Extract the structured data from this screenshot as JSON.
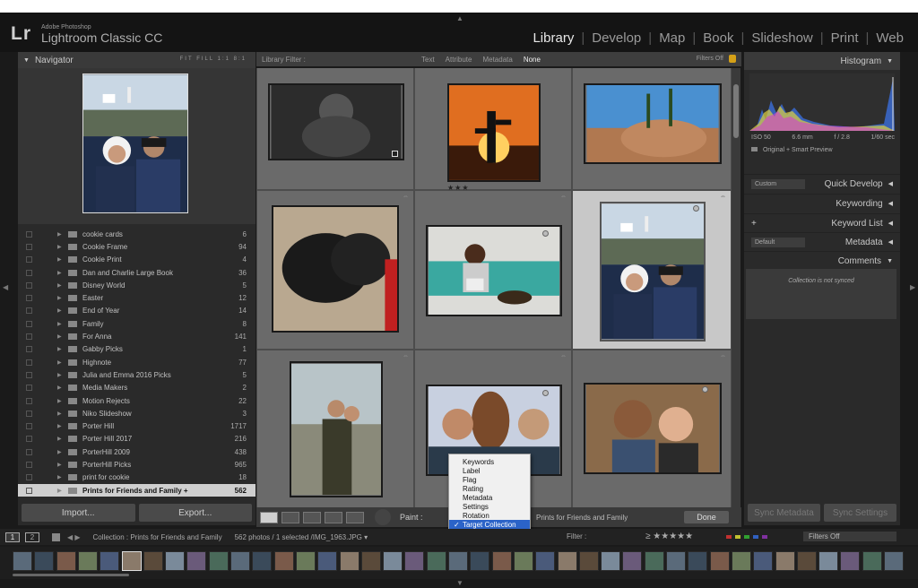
{
  "app": {
    "brand_small": "Adobe Photoshop",
    "brand_big": "Lightroom Classic CC",
    "logo": "Lr",
    "modules": [
      "Library",
      "Develop",
      "Map",
      "Book",
      "Slideshow",
      "Print",
      "Web"
    ],
    "active_module": "Library"
  },
  "navigator": {
    "title": "Navigator",
    "zoom_options": "FIT  FILL  1:1  8:1"
  },
  "collections": [
    {
      "name": "cookie cards",
      "count": "6"
    },
    {
      "name": "Cookie Frame",
      "count": "94"
    },
    {
      "name": "Cookie Print",
      "count": "4"
    },
    {
      "name": "Dan and Charlie Large Book",
      "count": "36"
    },
    {
      "name": "Disney World",
      "count": "5"
    },
    {
      "name": "Easter",
      "count": "12"
    },
    {
      "name": "End of Year",
      "count": "14"
    },
    {
      "name": "Family",
      "count": "8"
    },
    {
      "name": "For Anna",
      "count": "141"
    },
    {
      "name": "Gabby Picks",
      "count": "1"
    },
    {
      "name": "Highnote",
      "count": "77"
    },
    {
      "name": "Julia and Emma 2016 Picks",
      "count": "5"
    },
    {
      "name": "Media Makers",
      "count": "2"
    },
    {
      "name": "Motion Rejects",
      "count": "22"
    },
    {
      "name": "Niko Slideshow",
      "count": "3"
    },
    {
      "name": "Porter Hill",
      "count": "1717"
    },
    {
      "name": "Porter Hill 2017",
      "count": "216"
    },
    {
      "name": "PorterHill 2009",
      "count": "438"
    },
    {
      "name": "PorterHill Picks",
      "count": "965"
    },
    {
      "name": "print for cookie",
      "count": "18"
    },
    {
      "name": "Prints for Friends and Family +",
      "count": "562",
      "selected": true
    }
  ],
  "left_buttons": {
    "import": "Import...",
    "export": "Export..."
  },
  "filter_bar": {
    "title": "Library Filter :",
    "tabs": [
      "Text",
      "Attribute",
      "Metadata",
      "None"
    ],
    "active_tab": "None",
    "filters_off": "Filters Off"
  },
  "grid": {
    "rating_cell_stars": "★★★"
  },
  "right_panel": {
    "histogram_title": "Histogram",
    "iso": "ISO 50",
    "focal": "6.6 mm",
    "aperture": "f / 2.8",
    "shutter": "1/60 sec",
    "preview_label": "Original + Smart Preview",
    "quick_develop": "Quick Develop",
    "quick_develop_preset": "Custom",
    "keywording": "Keywording",
    "keyword_list": "Keyword List",
    "metadata": "Metadata",
    "metadata_preset": "Default",
    "comments": "Comments",
    "comments_note": "Collection is not synced",
    "sync_metadata": "Sync Metadata",
    "sync_settings": "Sync Settings"
  },
  "toolbar": {
    "paint_label": "Paint :",
    "paint_target": "Prints for Friends and Family",
    "done": "Done"
  },
  "dropdown": {
    "items": [
      "Keywords",
      "Label",
      "Flag",
      "Rating",
      "Metadata",
      "Settings",
      "Rotation",
      "Target Collection"
    ],
    "selected": "Target Collection"
  },
  "bottombar": {
    "page1": "1",
    "page2": "2",
    "source": "Collection : Prints for Friends and Family",
    "count": "562 photos / 1 selected /IMG_1963.JPG ▾",
    "filter_label": "Filter :",
    "stars": "≥ ★★★★★",
    "filters_off": "Filters Off"
  },
  "colors": {
    "accent_blue": "#2b63c8",
    "lock_gold": "#d4a017"
  }
}
